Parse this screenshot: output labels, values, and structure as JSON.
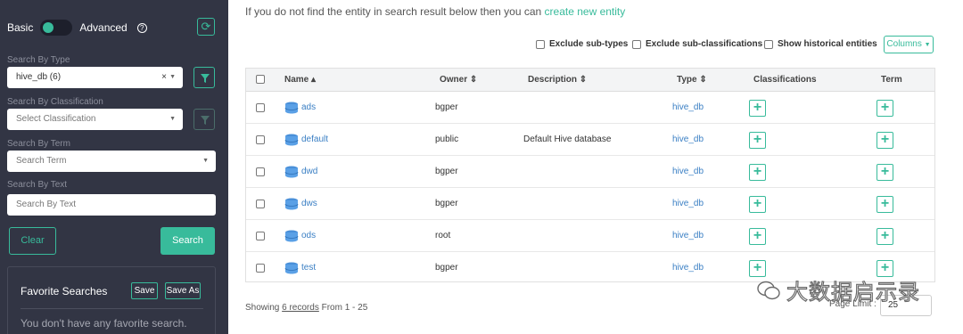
{
  "sidebar": {
    "mode_basic": "Basic",
    "mode_advanced": "Advanced",
    "search_by_type": {
      "label": "Search By Type",
      "value": "hive_db (6)",
      "clear": "×"
    },
    "search_by_classification": {
      "label": "Search By Classification",
      "placeholder": "Select Classification"
    },
    "search_by_term": {
      "label": "Search By Term",
      "placeholder": "Search Term"
    },
    "search_by_text": {
      "label": "Search By Text",
      "placeholder": "Search By Text"
    },
    "clear_label": "Clear",
    "search_label": "Search",
    "favorites": {
      "title": "Favorite Searches",
      "save_label": "Save",
      "save_as_label": "Save As",
      "empty_text": "You don't have any favorite search."
    }
  },
  "main": {
    "info_text": "If you do not find the entity in search result below then you can",
    "create_link": "create new entity",
    "options": {
      "exclude_subtypes": "Exclude sub-types",
      "exclude_subclassifications": "Exclude sub-classifications",
      "show_historical": "Show historical entities"
    },
    "columns_label": "Columns",
    "table": {
      "headers": {
        "name": "Name ▴",
        "owner": "Owner ⇕",
        "description": "Description ⇕",
        "type": "Type ⇕",
        "classifications": "Classifications",
        "term": "Term"
      },
      "rows": [
        {
          "name": "ads",
          "owner": "bgper",
          "description": "",
          "type": "hive_db"
        },
        {
          "name": "default",
          "owner": "public",
          "description": "Default Hive database",
          "type": "hive_db"
        },
        {
          "name": "dwd",
          "owner": "bgper",
          "description": "",
          "type": "hive_db"
        },
        {
          "name": "dws",
          "owner": "bgper",
          "description": "",
          "type": "hive_db"
        },
        {
          "name": "ods",
          "owner": "root",
          "description": "",
          "type": "hive_db"
        },
        {
          "name": "test",
          "owner": "bgper",
          "description": "",
          "type": "hive_db"
        }
      ]
    },
    "footer": {
      "showing_prefix": "Showing",
      "records_link": "6 records",
      "range_text": "From 1 - 25",
      "page_limit_label": "Page Limit :",
      "page_limit_value": "25"
    },
    "watermark": "大数据启示录"
  },
  "colors": {
    "accent": "#38bb9b",
    "sidebar_bg": "#323544",
    "link": "#3a7fc4"
  }
}
